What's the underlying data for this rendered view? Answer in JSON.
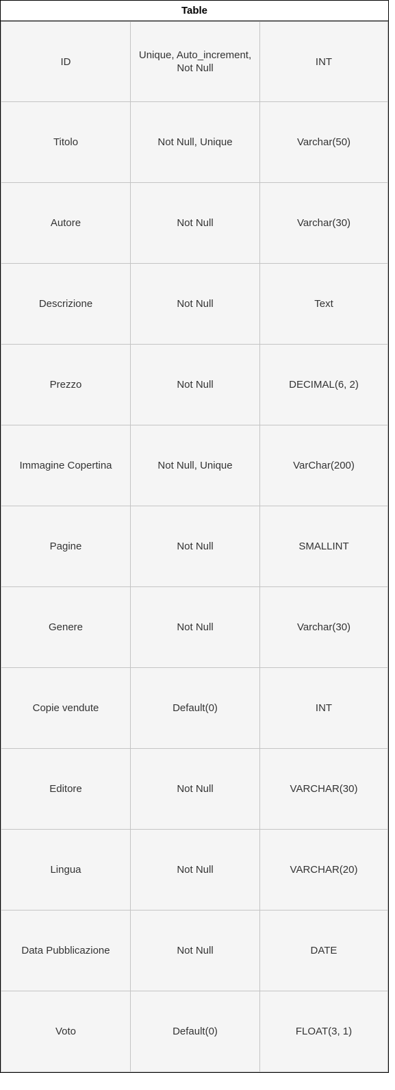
{
  "table": {
    "title": "Table",
    "rows": [
      [
        "ID",
        "Unique, Auto_increment, Not Null",
        "INT"
      ],
      [
        "Titolo",
        "Not Null, Unique",
        "Varchar(50)"
      ],
      [
        "Autore",
        "Not Null",
        "Varchar(30)"
      ],
      [
        "Descrizione",
        "Not Null",
        "Text"
      ],
      [
        "Prezzo",
        "Not Null",
        "DECIMAL(6, 2)"
      ],
      [
        "Immagine Copertina",
        "Not Null, Unique",
        "VarChar(200)"
      ],
      [
        "Pagine",
        "Not Null",
        "SMALLINT"
      ],
      [
        "Genere",
        "Not Null",
        "Varchar(30)"
      ],
      [
        "Copie vendute",
        "Default(0)",
        "INT"
      ],
      [
        "Editore",
        "Not Null",
        "VARCHAR(30)"
      ],
      [
        "Lingua",
        "Not Null",
        "VARCHAR(20)"
      ],
      [
        "Data Pubblicazione",
        "Not Null",
        "DATE"
      ],
      [
        "Voto",
        "Default(0)",
        "FLOAT(3, 1)"
      ]
    ]
  },
  "colors": {
    "header_border": "#000000",
    "cell_background": "#f5f5f5",
    "cell_border": "#c4c4c4",
    "cell_text": "#333333"
  }
}
